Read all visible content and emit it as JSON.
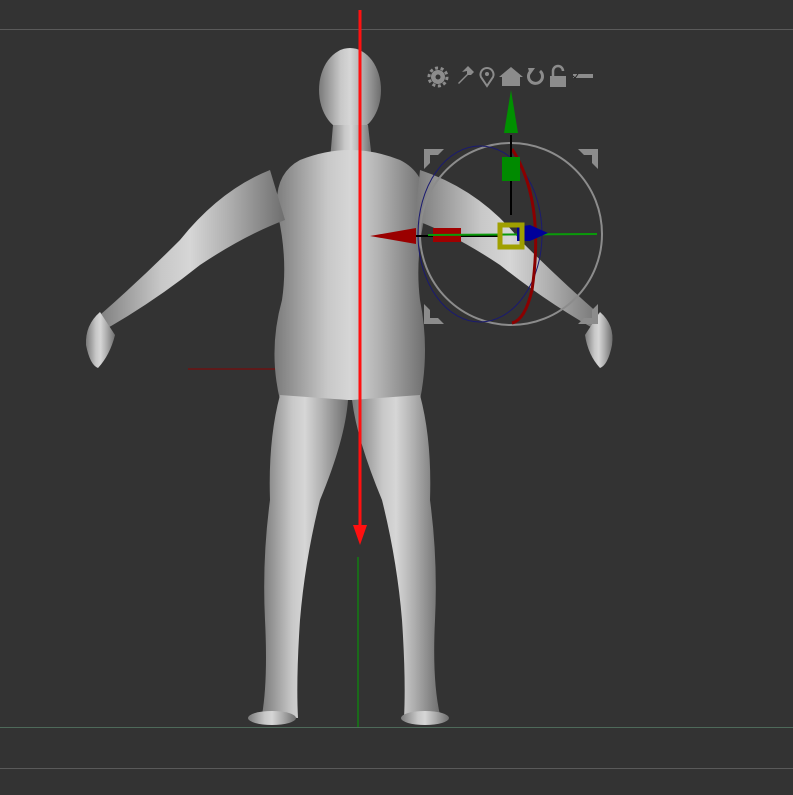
{
  "viewport": {
    "background": "#333333",
    "frame_line_color": "#5a5a5a",
    "floor_line_color": "#4e6a5a"
  },
  "gizmo": {
    "toolbar_icons": [
      "gear-icon",
      "pin-icon",
      "location-icon",
      "home-icon",
      "reset-icon",
      "lock-icon",
      "toggle-icon"
    ],
    "axis_colors": {
      "x": "#a00000",
      "y": "#00a000",
      "z": "#00008c",
      "center": "#a0a000"
    }
  },
  "transpose_line_color": "#ff1010"
}
